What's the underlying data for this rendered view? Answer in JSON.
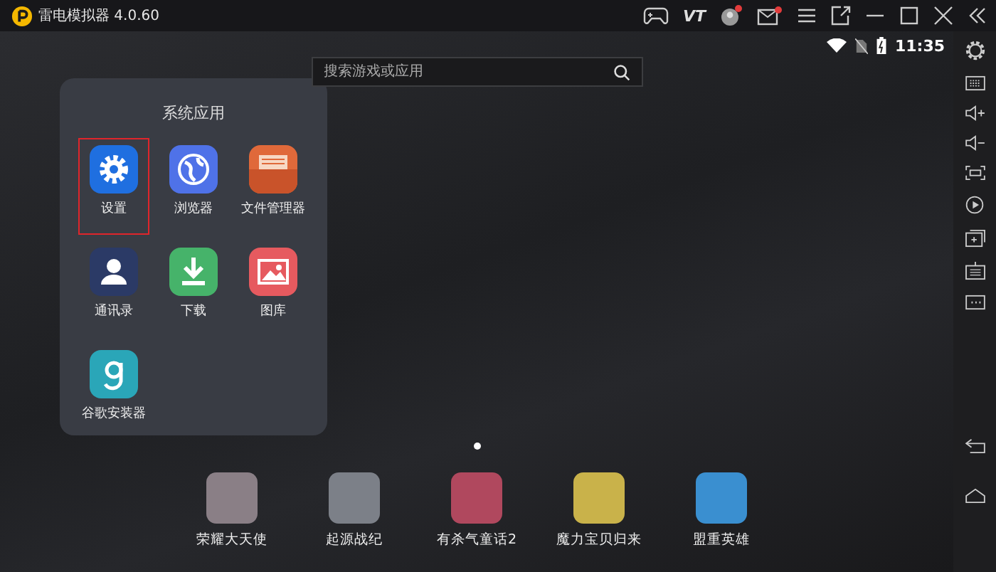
{
  "window": {
    "title": "雷电模拟器 4.0.60",
    "vt_label": "VT"
  },
  "status_bar": {
    "time": "11:35"
  },
  "search": {
    "placeholder": "搜索游戏或应用"
  },
  "folder": {
    "title": "系统应用",
    "apps": [
      {
        "label": "设置",
        "kind": "settings",
        "selected": true
      },
      {
        "label": "浏览器",
        "kind": "browser",
        "selected": false
      },
      {
        "label": "文件管理器",
        "kind": "files",
        "selected": false
      },
      {
        "label": "通讯录",
        "kind": "contacts",
        "selected": false
      },
      {
        "label": "下载",
        "kind": "download",
        "selected": false
      },
      {
        "label": "图库",
        "kind": "gallery",
        "selected": false
      },
      {
        "label": "谷歌安装器",
        "kind": "google",
        "selected": false
      }
    ]
  },
  "dock": [
    {
      "label": "荣耀大天使"
    },
    {
      "label": "起源战纪"
    },
    {
      "label": "有杀气童话2"
    },
    {
      "label": "魔力宝贝归来"
    },
    {
      "label": "盟重英雄"
    }
  ]
}
